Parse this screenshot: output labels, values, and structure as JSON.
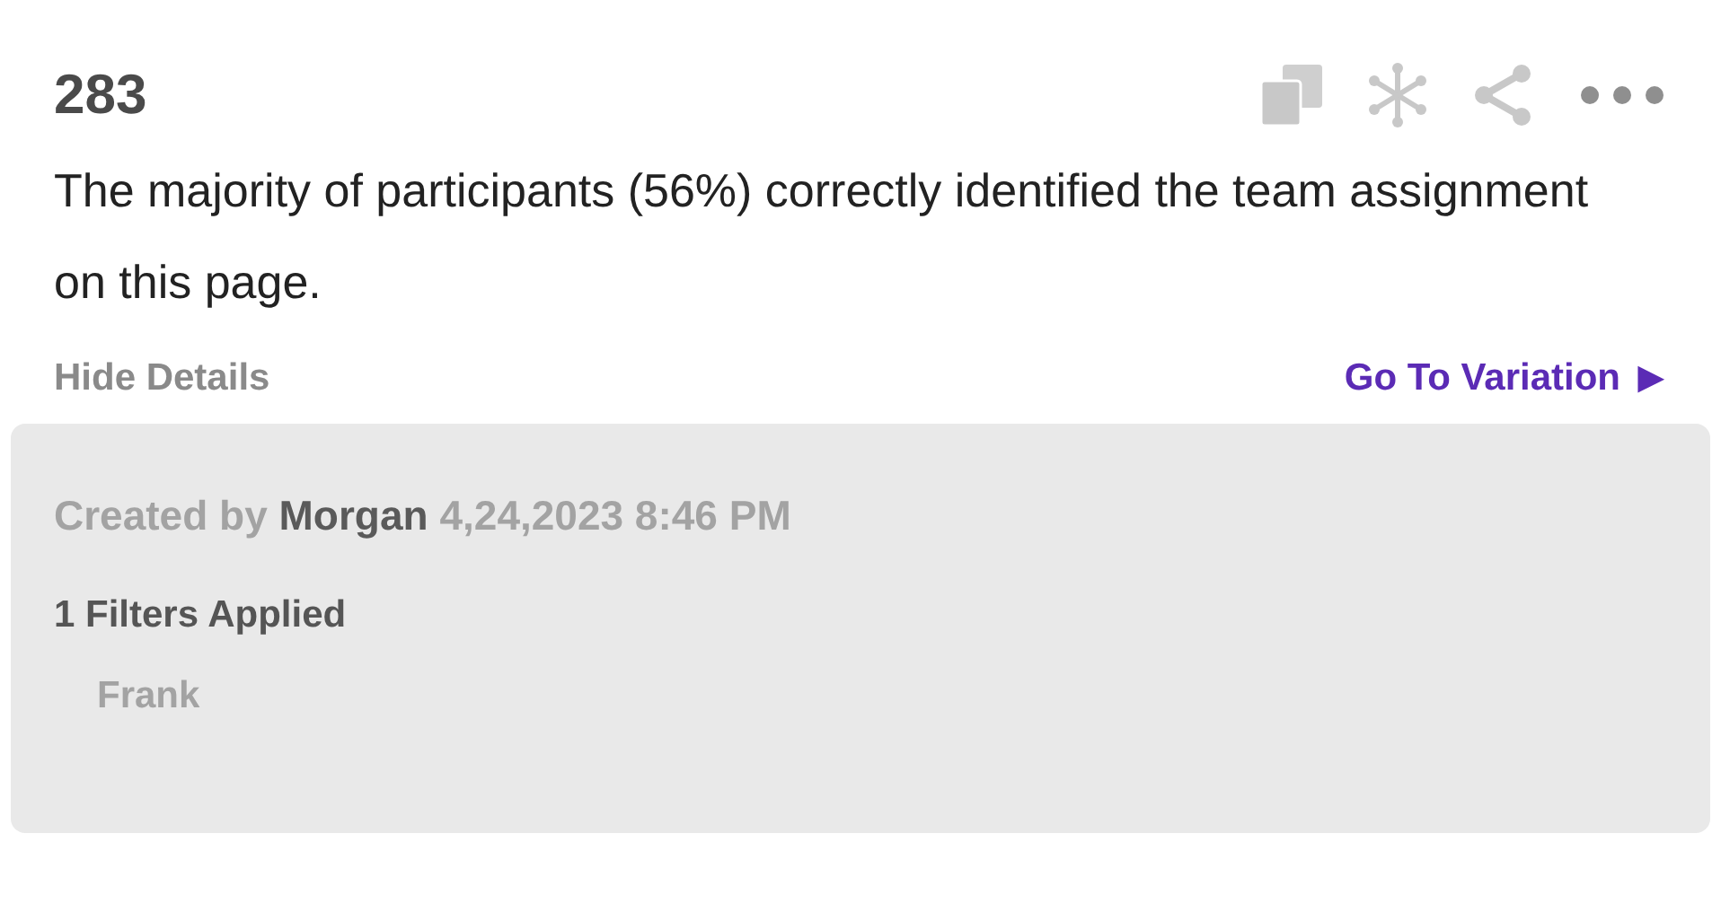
{
  "card": {
    "number": "283",
    "text": "The majority of participants (56%) correctly identified the team assignment on this page.",
    "hide_details": "Hide Details",
    "go_to": "Go To Variation",
    "go_arrow": "▶"
  },
  "details": {
    "created_prefix": "Created by",
    "author": "Morgan",
    "date": "4,24,2023 8:46 PM",
    "filters_title": "1 Filters Applied",
    "filters": [
      "Frank"
    ]
  }
}
